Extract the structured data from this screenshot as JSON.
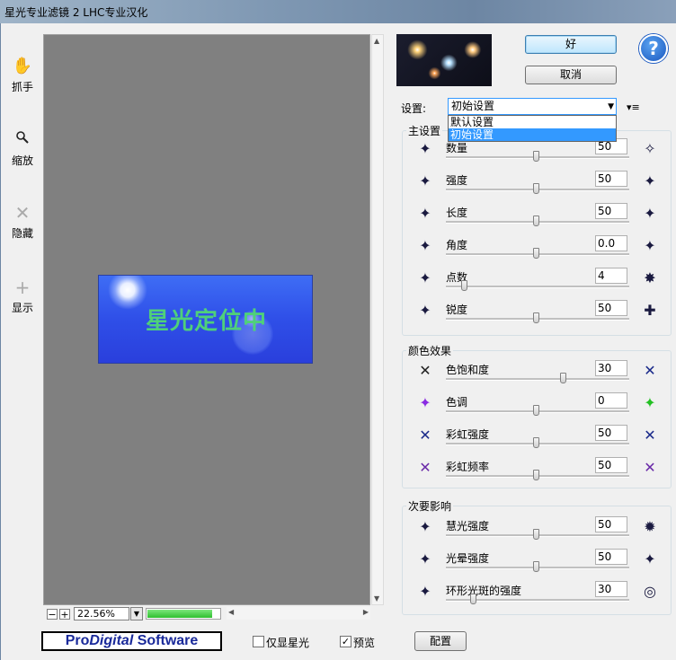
{
  "window": {
    "title": "星光专业滤镜 2 LHC专业汉化"
  },
  "tools": [
    {
      "label": "抓手",
      "icon": "hand-icon"
    },
    {
      "label": "缩放",
      "icon": "magnifier-icon"
    },
    {
      "label": "隐藏",
      "icon": "x-icon"
    },
    {
      "label": "显示",
      "icon": "plus-icon"
    }
  ],
  "preview": {
    "banner_text": "星光定位中"
  },
  "zoom": {
    "minus": "−",
    "plus": "+",
    "value": "22.56%",
    "progress": 0.9
  },
  "buttons": {
    "ok": "好",
    "cancel": "取消",
    "config": "配置",
    "help": "?"
  },
  "preset": {
    "label": "设置:",
    "selected": "初始设置",
    "options": [
      "默认设置",
      "初始设置"
    ]
  },
  "main_group": {
    "title": "主设置",
    "params": [
      {
        "label": "数量",
        "value": "50",
        "level": 0.5
      },
      {
        "label": "强度",
        "value": "50",
        "level": 0.5
      },
      {
        "label": "长度",
        "value": "50",
        "level": 0.5
      },
      {
        "label": "角度",
        "value": "0.0",
        "level": 0.5
      },
      {
        "label": "点数",
        "value": "4",
        "level": 0.1
      },
      {
        "label": "锐度",
        "value": "50",
        "level": 0.5
      }
    ]
  },
  "color_group": {
    "title": "颜色效果",
    "params": [
      {
        "label": "色饱和度",
        "value": "30",
        "level": 0.65
      },
      {
        "label": "色调",
        "value": "0",
        "level": 0.5
      },
      {
        "label": "彩虹强度",
        "value": "50",
        "level": 0.5
      },
      {
        "label": "彩虹频率",
        "value": "50",
        "level": 0.5
      }
    ]
  },
  "secondary_group": {
    "title": "次要影响",
    "params": [
      {
        "label": "慧光强度",
        "value": "50",
        "level": 0.5
      },
      {
        "label": "光晕强度",
        "value": "50",
        "level": 0.5
      },
      {
        "label": "环形光斑的强度",
        "value": "30",
        "level": 0.15
      }
    ]
  },
  "bottom": {
    "logo_pro": "Pro",
    "logo_digital": "Digital",
    "logo_software": " Software",
    "star_only_label": "仅显星光",
    "star_only_checked": false,
    "preview_label": "预览",
    "preview_checked": true,
    "check_mark": "✓"
  },
  "colors": {
    "accent": "#3399ff",
    "banner_text": "#4fd07a",
    "banner_bg": "#2f4fe8"
  }
}
